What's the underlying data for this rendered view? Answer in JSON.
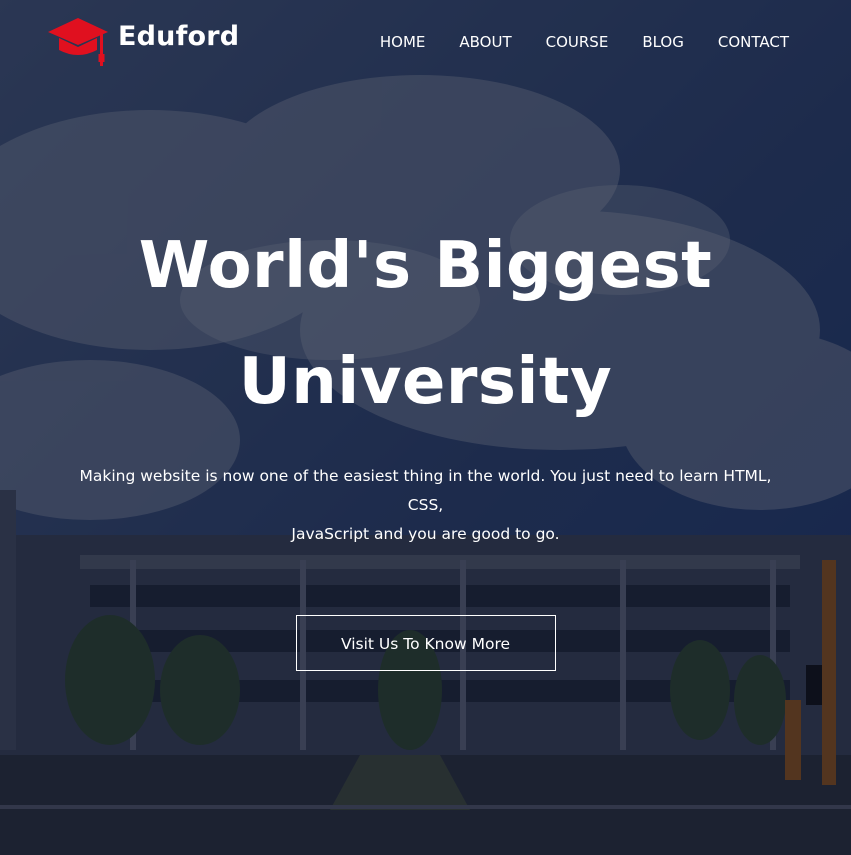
{
  "brand": {
    "name": "Eduford",
    "logo_icon": "graduation-cap-icon",
    "accent_color": "#e0101f"
  },
  "nav": {
    "items": [
      {
        "label": "HOME"
      },
      {
        "label": "ABOUT"
      },
      {
        "label": "COURSE"
      },
      {
        "label": "BLOG"
      },
      {
        "label": "CONTACT"
      }
    ]
  },
  "hero": {
    "title_line1": "World's Biggest",
    "title_line2": "University",
    "subtitle_line1": "Making website is now one of the easiest thing in the world. You just need to learn HTML, CSS,",
    "subtitle_line2": "JavaScript and you are good to go.",
    "cta_label": "Visit Us To Know More"
  }
}
